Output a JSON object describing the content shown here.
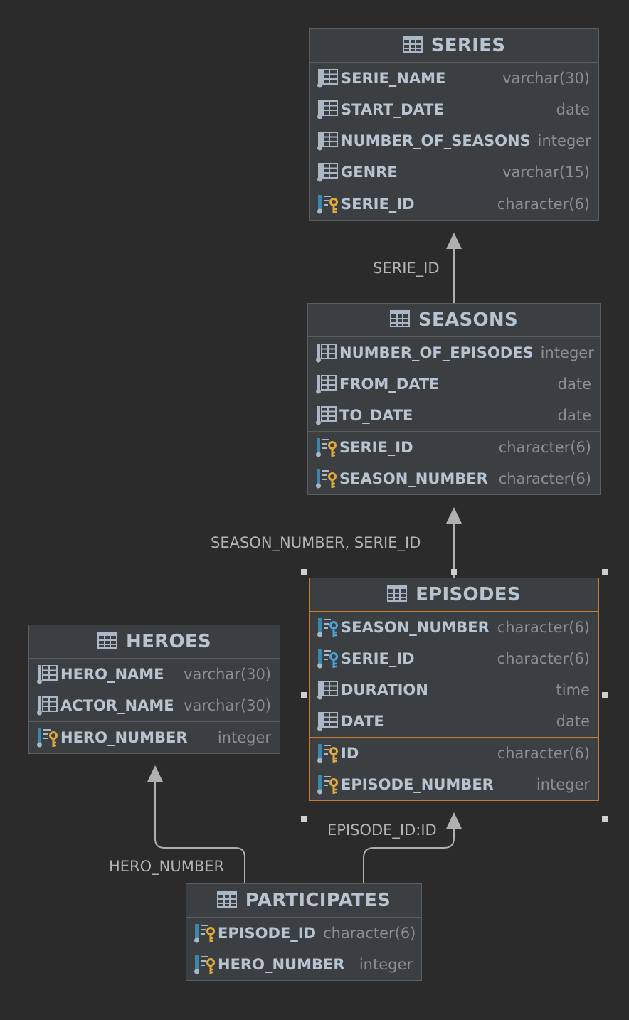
{
  "colors": {
    "background": "#2b2b2b",
    "table_bg": "#3c3f41",
    "table_border": "#5a5d60",
    "selected_border": "#c67a32",
    "column_name": "#b7c5d3",
    "column_type": "#8c8f92",
    "edge": "#b0b0b0",
    "primary_key_icon": "#e3a93b",
    "foreign_key_icon": "#4aa3d8"
  },
  "tables": {
    "series": {
      "title": "SERIES",
      "icon": "table-grid-icon",
      "columns": [
        {
          "name": "SERIE_NAME",
          "type": "varchar(30)",
          "icon": "column-icon"
        },
        {
          "name": "START_DATE",
          "type": "date",
          "icon": "column-icon"
        },
        {
          "name": "NUMBER_OF_SEASONS",
          "type": "integer",
          "icon": "column-icon"
        },
        {
          "name": "GENRE",
          "type": "varchar(15)",
          "icon": "column-icon"
        }
      ],
      "keys": [
        {
          "name": "SERIE_ID",
          "type": "character(6)",
          "icon": "primary-key-icon"
        }
      ]
    },
    "seasons": {
      "title": "SEASONS",
      "icon": "table-grid-icon",
      "columns": [
        {
          "name": "NUMBER_OF_EPISODES",
          "type": "integer",
          "icon": "column-icon"
        },
        {
          "name": "FROM_DATE",
          "type": "date",
          "icon": "column-icon"
        },
        {
          "name": "TO_DATE",
          "type": "date",
          "icon": "column-icon"
        }
      ],
      "keys": [
        {
          "name": "SERIE_ID",
          "type": "character(6)",
          "icon": "primary-foreign-key-icon"
        },
        {
          "name": "SEASON_NUMBER",
          "type": "character(6)",
          "icon": "primary-key-icon"
        }
      ]
    },
    "episodes": {
      "title": "EPISODES",
      "icon": "table-grid-icon",
      "selected": true,
      "columns": [
        {
          "name": "SEASON_NUMBER",
          "type": "character(6)",
          "icon": "foreign-key-icon"
        },
        {
          "name": "SERIE_ID",
          "type": "character(6)",
          "icon": "foreign-key-icon"
        },
        {
          "name": "DURATION",
          "type": "time",
          "icon": "column-icon"
        },
        {
          "name": "DATE",
          "type": "date",
          "icon": "column-icon"
        }
      ],
      "keys": [
        {
          "name": "ID",
          "type": "character(6)",
          "icon": "primary-key-icon"
        },
        {
          "name": "EPISODE_NUMBER",
          "type": "integer",
          "icon": "primary-key-icon"
        }
      ]
    },
    "heroes": {
      "title": "HEROES",
      "icon": "table-grid-icon",
      "columns": [
        {
          "name": "HERO_NAME",
          "type": "varchar(30)",
          "icon": "column-icon"
        },
        {
          "name": "ACTOR_NAME",
          "type": "varchar(30)",
          "icon": "column-icon"
        }
      ],
      "keys": [
        {
          "name": "HERO_NUMBER",
          "type": "integer",
          "icon": "primary-key-icon"
        }
      ]
    },
    "participates": {
      "title": "PARTICIPATES",
      "icon": "table-grid-icon",
      "columns": [],
      "keys": [
        {
          "name": "EPISODE_ID",
          "type": "character(6)",
          "icon": "primary-key-icon"
        },
        {
          "name": "HERO_NUMBER",
          "type": "integer",
          "icon": "primary-key-icon"
        }
      ]
    }
  },
  "relationships": [
    {
      "from": "SEASONS",
      "to": "SERIES",
      "label": "SERIE_ID"
    },
    {
      "from": "EPISODES",
      "to": "SEASONS",
      "label": "SEASON_NUMBER, SERIE_ID"
    },
    {
      "from": "PARTICIPATES",
      "to": "HEROES",
      "label": "HERO_NUMBER"
    },
    {
      "from": "PARTICIPATES",
      "to": "EPISODES",
      "label": "EPISODE_ID:ID"
    }
  ]
}
